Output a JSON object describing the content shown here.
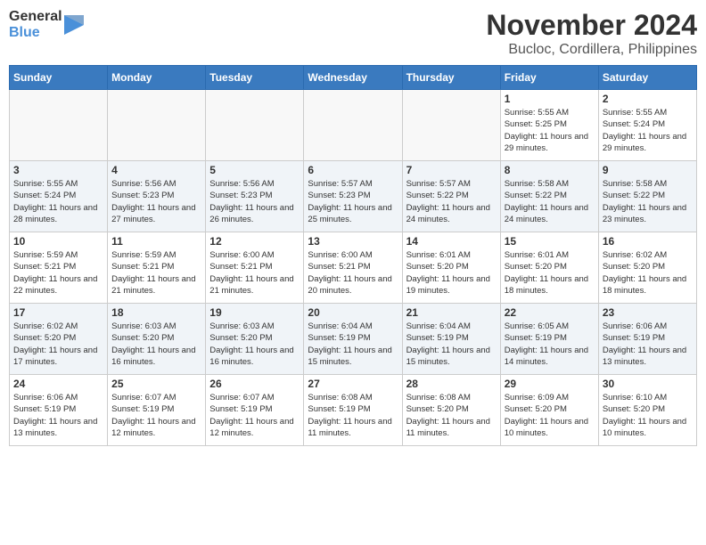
{
  "header": {
    "logo_general": "General",
    "logo_blue": "Blue",
    "month_title": "November 2024",
    "location": "Bucloc, Cordillera, Philippines"
  },
  "days_of_week": [
    "Sunday",
    "Monday",
    "Tuesday",
    "Wednesday",
    "Thursday",
    "Friday",
    "Saturday"
  ],
  "weeks": [
    [
      {
        "day": "",
        "info": ""
      },
      {
        "day": "",
        "info": ""
      },
      {
        "day": "",
        "info": ""
      },
      {
        "day": "",
        "info": ""
      },
      {
        "day": "",
        "info": ""
      },
      {
        "day": "1",
        "info": "Sunrise: 5:55 AM\nSunset: 5:25 PM\nDaylight: 11 hours and 29 minutes."
      },
      {
        "day": "2",
        "info": "Sunrise: 5:55 AM\nSunset: 5:24 PM\nDaylight: 11 hours and 29 minutes."
      }
    ],
    [
      {
        "day": "3",
        "info": "Sunrise: 5:55 AM\nSunset: 5:24 PM\nDaylight: 11 hours and 28 minutes."
      },
      {
        "day": "4",
        "info": "Sunrise: 5:56 AM\nSunset: 5:23 PM\nDaylight: 11 hours and 27 minutes."
      },
      {
        "day": "5",
        "info": "Sunrise: 5:56 AM\nSunset: 5:23 PM\nDaylight: 11 hours and 26 minutes."
      },
      {
        "day": "6",
        "info": "Sunrise: 5:57 AM\nSunset: 5:23 PM\nDaylight: 11 hours and 25 minutes."
      },
      {
        "day": "7",
        "info": "Sunrise: 5:57 AM\nSunset: 5:22 PM\nDaylight: 11 hours and 24 minutes."
      },
      {
        "day": "8",
        "info": "Sunrise: 5:58 AM\nSunset: 5:22 PM\nDaylight: 11 hours and 24 minutes."
      },
      {
        "day": "9",
        "info": "Sunrise: 5:58 AM\nSunset: 5:22 PM\nDaylight: 11 hours and 23 minutes."
      }
    ],
    [
      {
        "day": "10",
        "info": "Sunrise: 5:59 AM\nSunset: 5:21 PM\nDaylight: 11 hours and 22 minutes."
      },
      {
        "day": "11",
        "info": "Sunrise: 5:59 AM\nSunset: 5:21 PM\nDaylight: 11 hours and 21 minutes."
      },
      {
        "day": "12",
        "info": "Sunrise: 6:00 AM\nSunset: 5:21 PM\nDaylight: 11 hours and 21 minutes."
      },
      {
        "day": "13",
        "info": "Sunrise: 6:00 AM\nSunset: 5:21 PM\nDaylight: 11 hours and 20 minutes."
      },
      {
        "day": "14",
        "info": "Sunrise: 6:01 AM\nSunset: 5:20 PM\nDaylight: 11 hours and 19 minutes."
      },
      {
        "day": "15",
        "info": "Sunrise: 6:01 AM\nSunset: 5:20 PM\nDaylight: 11 hours and 18 minutes."
      },
      {
        "day": "16",
        "info": "Sunrise: 6:02 AM\nSunset: 5:20 PM\nDaylight: 11 hours and 18 minutes."
      }
    ],
    [
      {
        "day": "17",
        "info": "Sunrise: 6:02 AM\nSunset: 5:20 PM\nDaylight: 11 hours and 17 minutes."
      },
      {
        "day": "18",
        "info": "Sunrise: 6:03 AM\nSunset: 5:20 PM\nDaylight: 11 hours and 16 minutes."
      },
      {
        "day": "19",
        "info": "Sunrise: 6:03 AM\nSunset: 5:20 PM\nDaylight: 11 hours and 16 minutes."
      },
      {
        "day": "20",
        "info": "Sunrise: 6:04 AM\nSunset: 5:19 PM\nDaylight: 11 hours and 15 minutes."
      },
      {
        "day": "21",
        "info": "Sunrise: 6:04 AM\nSunset: 5:19 PM\nDaylight: 11 hours and 15 minutes."
      },
      {
        "day": "22",
        "info": "Sunrise: 6:05 AM\nSunset: 5:19 PM\nDaylight: 11 hours and 14 minutes."
      },
      {
        "day": "23",
        "info": "Sunrise: 6:06 AM\nSunset: 5:19 PM\nDaylight: 11 hours and 13 minutes."
      }
    ],
    [
      {
        "day": "24",
        "info": "Sunrise: 6:06 AM\nSunset: 5:19 PM\nDaylight: 11 hours and 13 minutes."
      },
      {
        "day": "25",
        "info": "Sunrise: 6:07 AM\nSunset: 5:19 PM\nDaylight: 11 hours and 12 minutes."
      },
      {
        "day": "26",
        "info": "Sunrise: 6:07 AM\nSunset: 5:19 PM\nDaylight: 11 hours and 12 minutes."
      },
      {
        "day": "27",
        "info": "Sunrise: 6:08 AM\nSunset: 5:19 PM\nDaylight: 11 hours and 11 minutes."
      },
      {
        "day": "28",
        "info": "Sunrise: 6:08 AM\nSunset: 5:20 PM\nDaylight: 11 hours and 11 minutes."
      },
      {
        "day": "29",
        "info": "Sunrise: 6:09 AM\nSunset: 5:20 PM\nDaylight: 11 hours and 10 minutes."
      },
      {
        "day": "30",
        "info": "Sunrise: 6:10 AM\nSunset: 5:20 PM\nDaylight: 11 hours and 10 minutes."
      }
    ]
  ]
}
